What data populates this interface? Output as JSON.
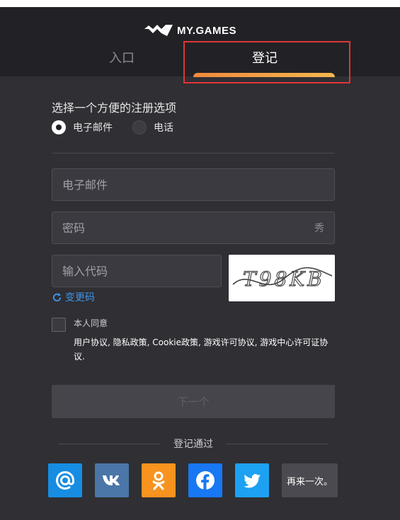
{
  "header": {
    "brand": "MY.GAMES",
    "tabs": {
      "login": "入口",
      "register": "登记"
    }
  },
  "form": {
    "choose_label": "选择一个方便的注册选项",
    "options": {
      "email": "电子邮件",
      "phone": "电话"
    },
    "selected_option": "email",
    "email_placeholder": "电子邮件",
    "password_placeholder": "密码",
    "show_password": "秀",
    "code_placeholder": "输入代码",
    "refresh_label": "变更码",
    "captcha_text": "T98KB",
    "consent_label": "本人同意",
    "consent_links": "用户协议, 隐私政策, Cookie政策, 游戏许可协议, 游戏中心许可证协议.",
    "next_button": "下一个"
  },
  "social": {
    "title": "登记通过",
    "icons": [
      "mail-ru-icon",
      "vk-icon",
      "odnoklassniki-icon",
      "facebook-icon",
      "twitter-icon"
    ],
    "retry_label": "再来一次。"
  },
  "colors": {
    "background": "#2f2f34",
    "header": "#222226",
    "accent_gradient_start": "#f08a3c",
    "accent_gradient_end": "#f4b74e",
    "link": "#3f93e6",
    "highlight_border": "#e03535"
  }
}
